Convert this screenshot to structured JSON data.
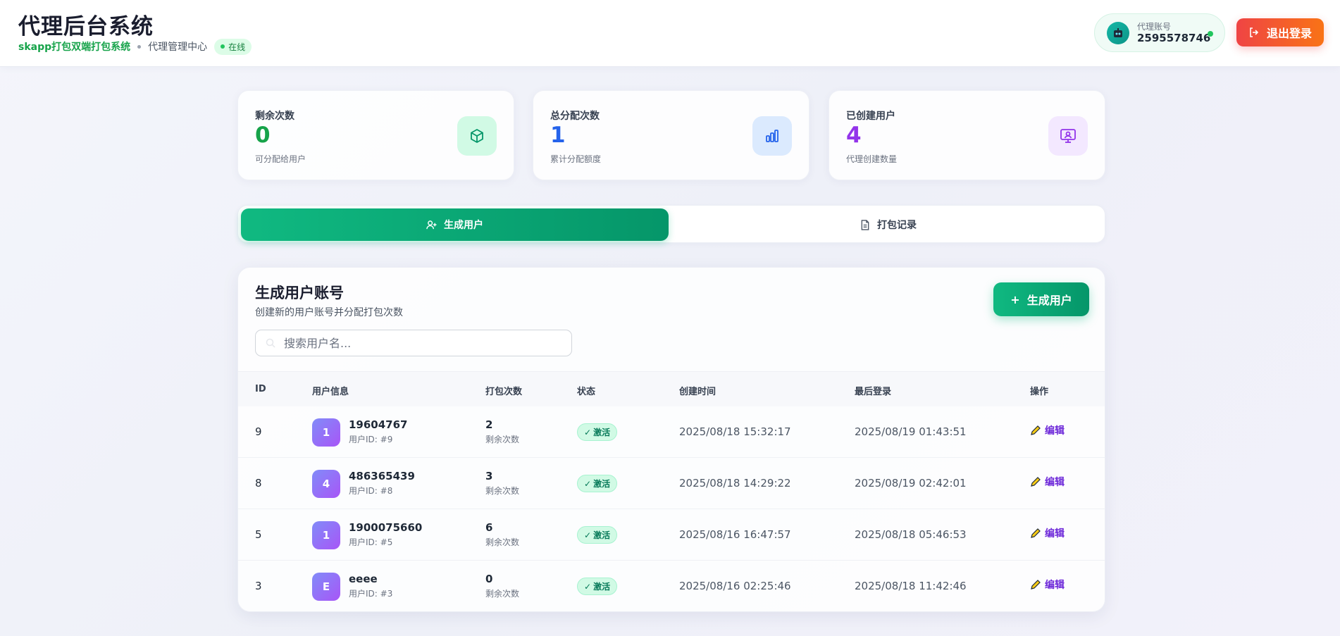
{
  "header": {
    "title": "代理后台系统",
    "app_name": "skapp打包双端打包系统",
    "center_name": "代理管理中心",
    "online_label": "在线",
    "account_label": "代理账号",
    "account_value": "2595578746",
    "logout_label": "退出登录"
  },
  "stats": [
    {
      "label": "剩余次数",
      "value": "0",
      "desc": "可分配给用户",
      "color": "#16a34a",
      "icon": "cube-icon"
    },
    {
      "label": "总分配次数",
      "value": "1",
      "desc": "累计分配额度",
      "color": "#2563eb",
      "icon": "bar-chart-icon"
    },
    {
      "label": "已创建用户",
      "value": "4",
      "desc": "代理创建数量",
      "color": "#9333ea",
      "icon": "monitor-user-icon"
    }
  ],
  "tabs": {
    "generate": "生成用户",
    "records": "打包记录"
  },
  "panel": {
    "title": "生成用户账号",
    "subtitle": "创建新的用户账号并分配打包次数",
    "generate_button": "生成用户",
    "search_placeholder": "搜索用户名..."
  },
  "table": {
    "headers": {
      "id": "ID",
      "user_info": "用户信息",
      "pack_count": "打包次数",
      "status": "状态",
      "created": "创建时间",
      "last_login": "最后登录",
      "action": "操作"
    },
    "rows": [
      {
        "id": "9",
        "avatar": "1",
        "name": "19604767",
        "uid": "用户ID: #9",
        "count": "2",
        "count_label": "剩余次数",
        "status": "激活",
        "created": "2025/08/18 15:32:17",
        "last_login": "2025/08/19 01:43:51",
        "edit": "编辑"
      },
      {
        "id": "8",
        "avatar": "4",
        "name": "486365439",
        "uid": "用户ID: #8",
        "count": "3",
        "count_label": "剩余次数",
        "status": "激活",
        "created": "2025/08/18 14:29:22",
        "last_login": "2025/08/19 02:42:01",
        "edit": "编辑"
      },
      {
        "id": "5",
        "avatar": "1",
        "name": "1900075660",
        "uid": "用户ID: #5",
        "count": "6",
        "count_label": "剩余次数",
        "status": "激活",
        "created": "2025/08/16 16:47:57",
        "last_login": "2025/08/18 05:46:53",
        "edit": "编辑"
      },
      {
        "id": "3",
        "avatar": "E",
        "name": "eeee",
        "uid": "用户ID: #3",
        "count": "0",
        "count_label": "剩余次数",
        "status": "激活",
        "created": "2025/08/16 02:25:46",
        "last_login": "2025/08/18 11:42:46",
        "edit": "编辑"
      }
    ]
  }
}
